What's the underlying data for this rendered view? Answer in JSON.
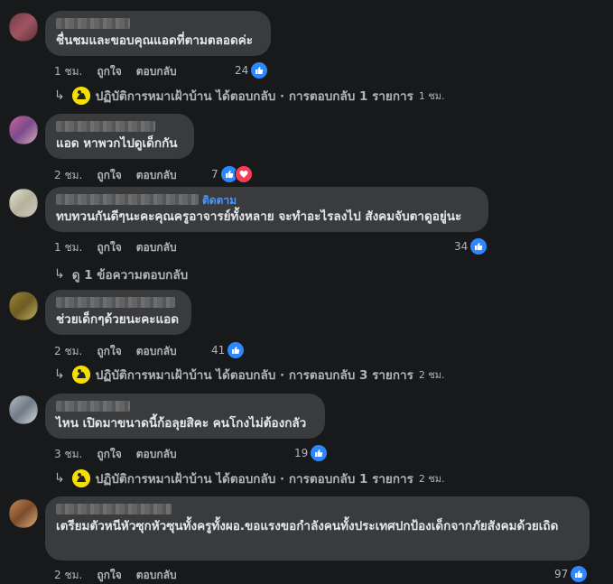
{
  "labels": {
    "like": "ถูกใจ",
    "reply": "ตอบกลับ"
  },
  "comments": [
    {
      "text": "ชื่นชมและขอบคุณแอดที่ตามตลอดค่ะ",
      "time": "1 ชม.",
      "reactions": "24",
      "reaction_icons": [
        "like-icon"
      ],
      "avatar_color": "#8a4b55",
      "reply": {
        "text": "ปฏิบัติการหมาเฝ้าบ้าน ได้ตอบกลับ · การตอบกลับ 1 รายการ",
        "time": "1 ชม."
      }
    },
    {
      "text": "แอด หาพวกไปดูเด็กกัน",
      "time": "2 ชม.",
      "reactions": "7",
      "reaction_icons": [
        "like-icon",
        "heart-icon"
      ],
      "avatar_color": "#a05d8a"
    },
    {
      "text": "ทบทวนกันดีๆนะคะคุณครูอาจารย์ทั้งหลาย จะทำอะไรลงไป สังคมจับตาดูอยู่นะ",
      "follow": "ติดตาม",
      "time": "1 ชม.",
      "reactions": "34",
      "reaction_icons": [
        "like-icon"
      ],
      "avatar_color": "#c9c7b8",
      "view_replies": "ดู 1 ข้อความตอบกลับ"
    },
    {
      "text": "ช่วยเด็กๆด้วยนะคะแอด",
      "time": "2 ชม.",
      "reactions": "41",
      "reaction_icons": [
        "like-icon"
      ],
      "avatar_color": "#8a7a3a",
      "reply": {
        "text": "ปฏิบัติการหมาเฝ้าบ้าน ได้ตอบกลับ · การตอบกลับ 3 รายการ",
        "time": "2 ชม."
      }
    },
    {
      "text": "ไหน เปิดมาขนาดนี้ก้อลุยสิคะ คนโกงไม่ต้องกลัว",
      "time": "3 ชม.",
      "reactions": "19",
      "reaction_icons": [
        "like-icon"
      ],
      "avatar_color": "#9aa3ad",
      "reply": {
        "text": "ปฏิบัติการหมาเฝ้าบ้าน ได้ตอบกลับ · การตอบกลับ 1 รายการ",
        "time": "2 ชม."
      }
    },
    {
      "text": "เตรียมตัวหนีหัวซุกหัวซุนทั้งครูทั้งผอ.ขอแรงขอกำลังคนทั้งประเทศปกป้องเด็กจากภัยสังคมด้วยเถิด",
      "time": "2 ชม.",
      "reactions": "97",
      "reaction_icons": [
        "like-icon"
      ],
      "avatar_color": "#b0784a"
    }
  ]
}
